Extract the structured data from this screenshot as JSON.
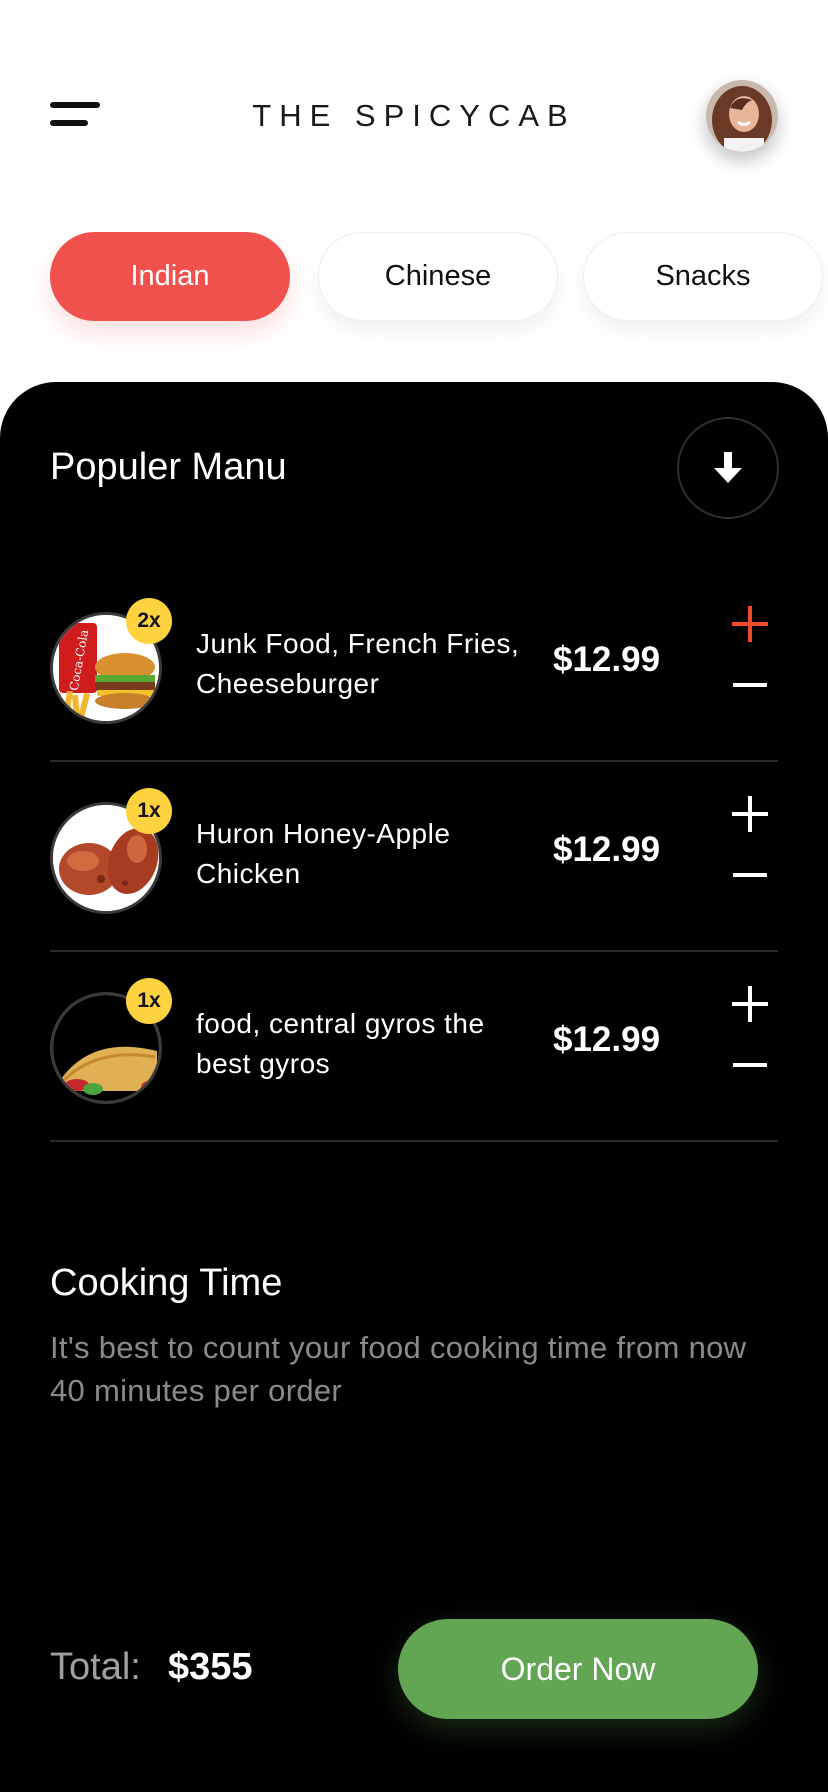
{
  "header": {
    "title": "THE SPICYCAB",
    "menu_icon": "hamburger-menu-icon",
    "avatar_icon": "user-avatar"
  },
  "tabs": [
    {
      "label": "Indian",
      "active": true
    },
    {
      "label": "Chinese",
      "active": false
    },
    {
      "label": "Snacks",
      "active": false
    }
  ],
  "menu": {
    "title": "Populer Manu",
    "toggle_icon": "arrow-down-icon",
    "items": [
      {
        "qty": "2x",
        "name": "Junk Food, French Fries, Cheeseburger",
        "price": "$12.99",
        "image": "burger-combo",
        "plus_color": "#f04a2e"
      },
      {
        "qty": "1x",
        "name": "Huron Honey-Apple Chicken",
        "price": "$12.99",
        "image": "roast-chicken",
        "plus_color": "#ffffff"
      },
      {
        "qty": "1x",
        "name": "food, central gyros the best gyros",
        "price": "$12.99",
        "image": "gyros-pastry",
        "plus_color": "#ffffff"
      }
    ]
  },
  "cooking": {
    "title": "Cooking Time",
    "description": "It's best to count your food cooking time from now 40 minutes per order"
  },
  "footer": {
    "total_label": "Total:",
    "total_value": "$355",
    "order_label": "Order Now"
  },
  "colors": {
    "accent_red": "#f0514c",
    "order_green": "#62a553",
    "qty_badge": "#ffd23f",
    "panel_bg": "#000000"
  }
}
